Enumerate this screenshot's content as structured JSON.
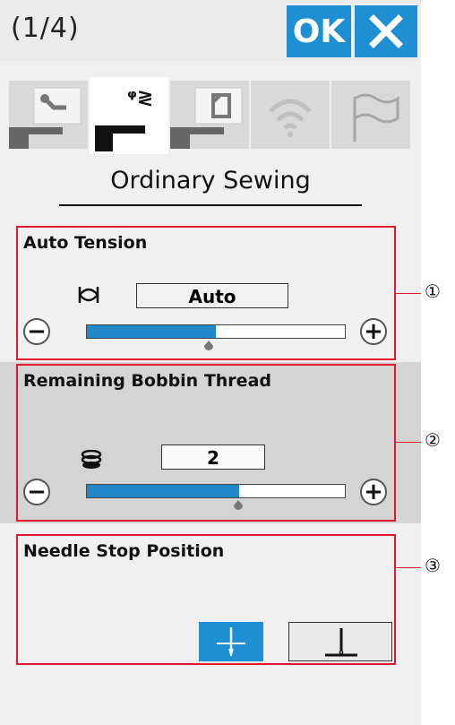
{
  "header": {
    "page_indicator": "(1/4)",
    "ok_label": "OK",
    "close_icon": "close-icon"
  },
  "tabs": [
    {
      "icon": "machine-wrench-icon",
      "active": false
    },
    {
      "icon": "machine-sewing-icon",
      "active": true
    },
    {
      "icon": "machine-embroidery-icon",
      "active": false
    },
    {
      "icon": "wifi-icon",
      "active": false
    },
    {
      "icon": "flag-icon",
      "active": false
    }
  ],
  "section_title": "Ordinary Sewing",
  "auto_tension": {
    "label": "Auto Tension",
    "value": "Auto",
    "icon": "tension-icon",
    "level": 0.5,
    "minus": "−",
    "plus": "+"
  },
  "bobbin": {
    "label": "Remaining Bobbin Thread",
    "value": "2",
    "icon": "bobbin-icon",
    "level": 0.59,
    "minus": "−",
    "plus": "+"
  },
  "needle_stop": {
    "label": "Needle Stop Position",
    "options": [
      "needle-up-icon",
      "needle-down-icon"
    ],
    "selected": "needle-up"
  },
  "callouts": [
    "①",
    "②",
    "③"
  ],
  "colors": {
    "accent": "#1f8fd3",
    "highlight_border": "#e0192d",
    "bar_fill": "#2388c9"
  }
}
